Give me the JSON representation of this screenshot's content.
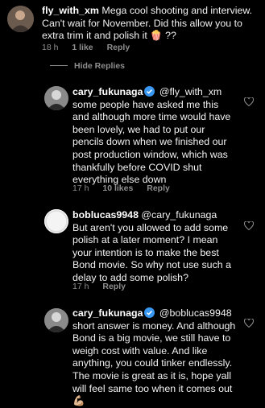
{
  "comments": [
    {
      "username": "fly_with_xm",
      "text": "Mega cool shooting and interview. Can't wait for November. Did this allow you to extra trim it and polish it 🍿 ??",
      "time": "18 h",
      "likes": "1 like",
      "reply_label": "Reply"
    },
    {
      "username": "cary_fukunaga",
      "verified": true,
      "text": "@fly_with_xm some people have asked me this and although more time would have been lovely, we had to put our pencils down when we finished our post production window, which was thankfully before COVID shut everything else down",
      "time": "17 h",
      "likes": "10 likes",
      "reply_label": "Reply"
    },
    {
      "username": "boblucas9948",
      "text": "@cary_fukunaga But aren't you allowed to add some polish at a later moment? I mean your intention is to make the best Bond movie. So why not use such a delay to add some polish?",
      "time": "17 h",
      "reply_label": "Reply"
    },
    {
      "username": "cary_fukunaga",
      "verified": true,
      "text": "@boblucas9948 short answer is money. And although Bond is a big movie, we still have to weigh cost with value. And like anything, you could tinker endlessly. The movie is great as it is, hope yall will feel same too when it comes out 💪🏼"
    }
  ],
  "hide_replies_label": "Hide Replies"
}
